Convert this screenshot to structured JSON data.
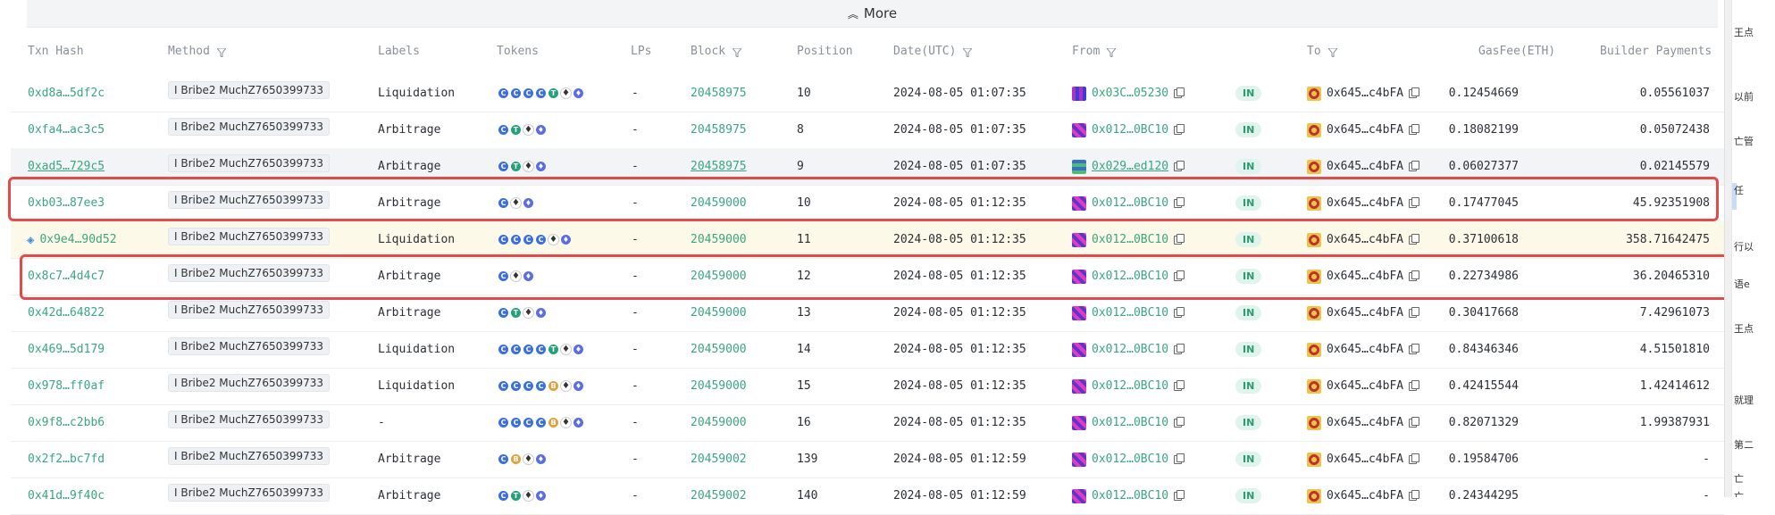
{
  "more_bar": {
    "label": "More"
  },
  "columns": [
    "Txn Hash",
    "Method",
    "Labels",
    "Tokens",
    "LPs",
    "Block",
    "Position",
    "Date(UTC)",
    "From",
    "To",
    "GasFee(ETH)",
    "Builder Payments"
  ],
  "rows": [
    {
      "hash": "0xd8a…5df2c",
      "method": "I Bribe2 MuchZ7650399733",
      "label": "Liquidation",
      "tokens": [
        "C",
        "C",
        "C",
        "C",
        "T",
        "eth",
        "blue"
      ],
      "lps": "-",
      "block": "20458975",
      "position": "10",
      "date": "2024-08-05 01:07:35",
      "from": "0x03C…05230",
      "dir": "IN",
      "to": "0x645…c4bFA",
      "gas": "0.12454669",
      "builder": "0.05561037"
    },
    {
      "hash": "0xfa4…ac3c5",
      "method": "I Bribe2 MuchZ7650399733",
      "label": "Arbitrage",
      "tokens": [
        "C",
        "T",
        "eth",
        "blue"
      ],
      "lps": "-",
      "block": "20458975",
      "position": "8",
      "date": "2024-08-05 01:07:35",
      "from": "0x012…0BC10",
      "dir": "IN",
      "to": "0x645…c4bFA",
      "gas": "0.18082199",
      "builder": "0.05072438"
    },
    {
      "hash": "0xad5…729c5",
      "method": "I Bribe2 MuchZ7650399733",
      "label": "Arbitrage",
      "tokens": [
        "C",
        "T",
        "eth",
        "blue"
      ],
      "lps": "-",
      "block": "20458975",
      "position": "9",
      "date": "2024-08-05 01:07:35",
      "from": "0x029…ed120",
      "dir": "IN",
      "to": "0x645…c4bFA",
      "gas": "0.06027377",
      "builder": "0.02145579"
    },
    {
      "hash": "0xb03…87ee3",
      "method": "I Bribe2 MuchZ7650399733",
      "label": "Arbitrage",
      "tokens": [
        "C",
        "eth",
        "blue"
      ],
      "lps": "-",
      "block": "20459000",
      "position": "10",
      "date": "2024-08-05 01:12:35",
      "from": "0x012…0BC10",
      "dir": "IN",
      "to": "0x645…c4bFA",
      "gas": "0.17477045",
      "builder": "45.92351908"
    },
    {
      "hash": "0x9e4…90d52",
      "method": "I Bribe2 MuchZ7650399733",
      "label": "Liquidation",
      "tokens": [
        "C",
        "C",
        "C",
        "C",
        "eth",
        "blue"
      ],
      "lps": "-",
      "block": "20459000",
      "position": "11",
      "date": "2024-08-05 01:12:35",
      "from": "0x012…0BC10",
      "dir": "IN",
      "to": "0x645…c4bFA",
      "gas": "0.37100618",
      "builder": "358.71642475"
    },
    {
      "hash": "0x8c7…4d4c7",
      "method": "I Bribe2 MuchZ7650399733",
      "label": "Arbitrage",
      "tokens": [
        "C",
        "eth",
        "blue"
      ],
      "lps": "-",
      "block": "20459000",
      "position": "12",
      "date": "2024-08-05 01:12:35",
      "from": "0x012…0BC10",
      "dir": "IN",
      "to": "0x645…c4bFA",
      "gas": "0.22734986",
      "builder": "36.20465310"
    },
    {
      "hash": "0x42d…64822",
      "method": "I Bribe2 MuchZ7650399733",
      "label": "Arbitrage",
      "tokens": [
        "C",
        "T",
        "eth",
        "blue"
      ],
      "lps": "-",
      "block": "20459000",
      "position": "13",
      "date": "2024-08-05 01:12:35",
      "from": "0x012…0BC10",
      "dir": "IN",
      "to": "0x645…c4bFA",
      "gas": "0.30417668",
      "builder": "7.42961073"
    },
    {
      "hash": "0x469…5d179",
      "method": "I Bribe2 MuchZ7650399733",
      "label": "Liquidation",
      "tokens": [
        "C",
        "C",
        "C",
        "C",
        "T",
        "eth",
        "blue"
      ],
      "lps": "-",
      "block": "20459000",
      "position": "14",
      "date": "2024-08-05 01:12:35",
      "from": "0x012…0BC10",
      "dir": "IN",
      "to": "0x645…c4bFA",
      "gas": "0.84346346",
      "builder": "4.51501810"
    },
    {
      "hash": "0x978…ff0af",
      "method": "I Bribe2 MuchZ7650399733",
      "label": "Liquidation",
      "tokens": [
        "C",
        "C",
        "C",
        "C",
        "B",
        "eth",
        "blue"
      ],
      "lps": "-",
      "block": "20459000",
      "position": "15",
      "date": "2024-08-05 01:12:35",
      "from": "0x012…0BC10",
      "dir": "IN",
      "to": "0x645…c4bFA",
      "gas": "0.42415544",
      "builder": "1.42414612"
    },
    {
      "hash": "0x9f8…c2bb6",
      "method": "I Bribe2 MuchZ7650399733",
      "label": "-",
      "tokens": [
        "C",
        "C",
        "C",
        "C",
        "B",
        "eth",
        "blue"
      ],
      "lps": "-",
      "block": "20459000",
      "position": "16",
      "date": "2024-08-05 01:12:35",
      "from": "0x012…0BC10",
      "dir": "IN",
      "to": "0x645…c4bFA",
      "gas": "0.82071329",
      "builder": "1.99387931"
    },
    {
      "hash": "0x2f2…bc7fd",
      "method": "I Bribe2 MuchZ7650399733",
      "label": "Arbitrage",
      "tokens": [
        "C",
        "B",
        "eth",
        "blue"
      ],
      "lps": "-",
      "block": "20459002",
      "position": "139",
      "date": "2024-08-05 01:12:59",
      "from": "0x012…0BC10",
      "dir": "IN",
      "to": "0x645…c4bFA",
      "gas": "0.19584706",
      "builder": "-"
    },
    {
      "hash": "0x41d…9f40c",
      "method": "I Bribe2 MuchZ7650399733",
      "label": "Arbitrage",
      "tokens": [
        "C",
        "T",
        "eth",
        "blue"
      ],
      "lps": "-",
      "block": "20459002",
      "position": "140",
      "date": "2024-08-05 01:12:59",
      "from": "0x012…0BC10",
      "dir": "IN",
      "to": "0x645…c4bFA",
      "gas": "0.24344295",
      "builder": "-"
    }
  ],
  "side_panel": [
    "王点",
    "以前",
    "亡管",
    "任",
    "行以",
    "语e",
    "王点",
    "就理",
    "第二",
    "亡",
    "亡"
  ],
  "colors": {
    "link": "#3aa67d",
    "in_badge": "#dff4ec",
    "highlight_box": "#e24b4b"
  }
}
